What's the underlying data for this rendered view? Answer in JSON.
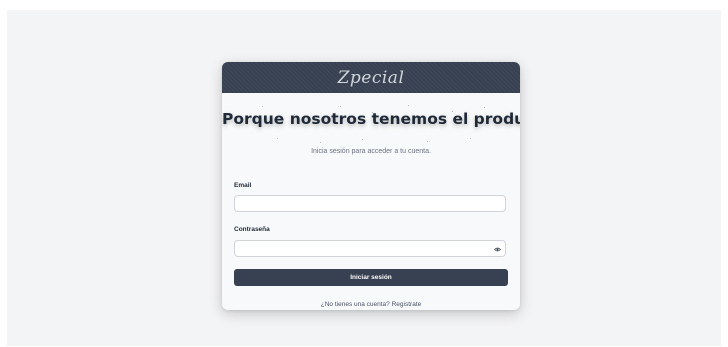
{
  "header": {
    "brand": "Zpecial"
  },
  "main": {
    "headline": "Porque nosotros tenemos el producto",
    "subtitle": "Inicia sesión para acceder a tu cuenta."
  },
  "form": {
    "email_label": "Email",
    "email_value": "",
    "password_label": "Contraseña",
    "password_value": "",
    "submit_label": "Iniciar sesión"
  },
  "footer": {
    "prompt": "¿No tienes una cuenta?",
    "link": "Registrate"
  },
  "colors": {
    "header_bg": "#374151",
    "button_bg": "#374151",
    "page_bg": "#f3f4f6",
    "card_bg": "#f8f9fa"
  },
  "icons": {
    "password_toggle": "eye-icon"
  }
}
